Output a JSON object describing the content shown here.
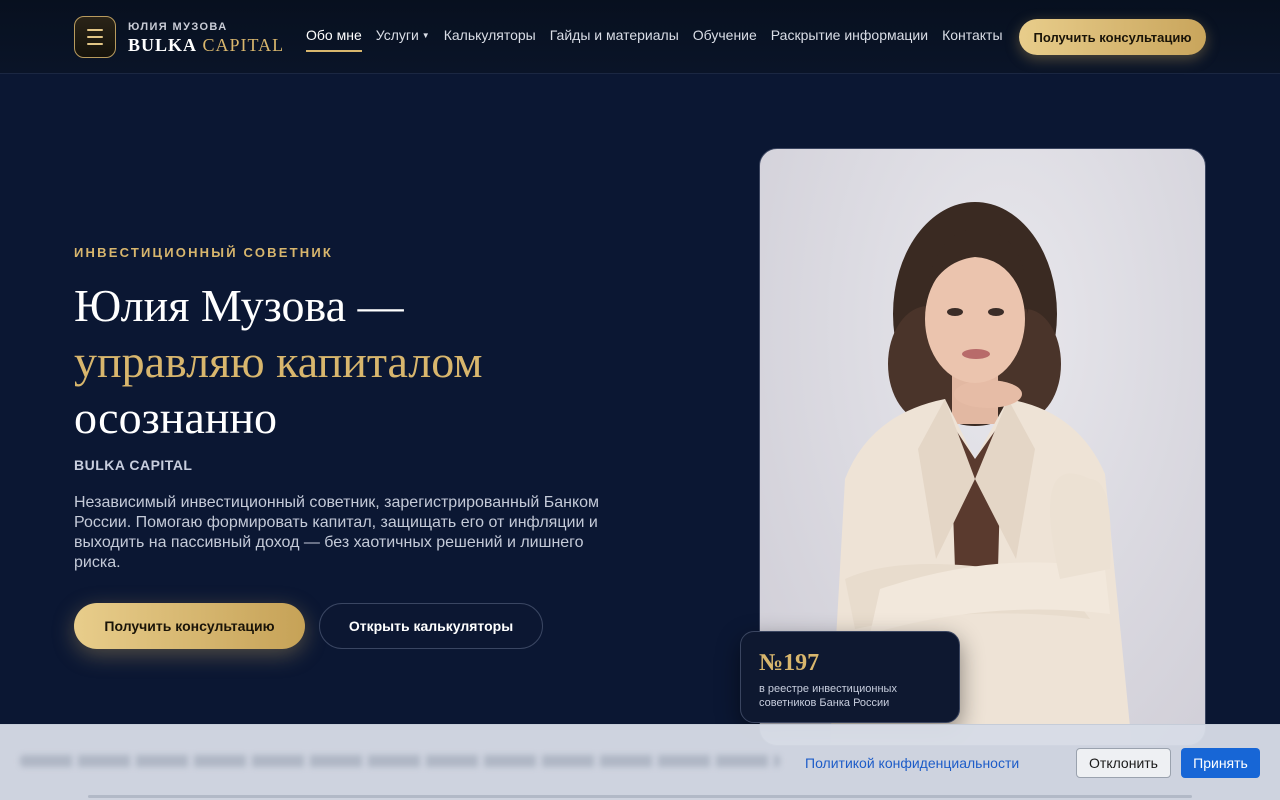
{
  "header": {
    "menu_icon": "hamburger-menu-icon",
    "brand_top": "ЮЛИЯ МУЗОВА",
    "brand_part1": "BULKA",
    "brand_part2": "CAPITAL",
    "nav": [
      {
        "label": "Обо мне",
        "active": true
      },
      {
        "label": "Услуги",
        "dropdown": true
      },
      {
        "label": "Калькуляторы"
      },
      {
        "label": "Гайды и материалы"
      },
      {
        "label": "Обучение"
      },
      {
        "label": "Раскрытие информации"
      },
      {
        "label": "Контакты"
      }
    ],
    "cta_label": "Получить консультацию"
  },
  "hero": {
    "eyebrow": "ИНВЕСТИЦИОННЫЙ СОВЕТНИК",
    "title_line1": "Юлия Музова —",
    "title_line2": "управляю капиталом",
    "title_line3": "осознанно",
    "sub_brand": "BULKA CAPITAL",
    "lead": "Независимый инвестиционный советник, зарегистрированный Банком России. Помогаю формировать капитал, защищать его от инфляции и выходить на пассивный доход — без хаотичных решений и лишнего риска.",
    "primary_button": "Получить консультацию",
    "secondary_button": "Открыть калькуляторы"
  },
  "badge": {
    "number": "№197",
    "text": "в реестре инвестиционных советников Банка России"
  },
  "cookie": {
    "policy_link": "Политикой конфиденциальности",
    "decline": "Отклонить",
    "accept": "Принять"
  },
  "colors": {
    "background": "#0b1733",
    "gold": "#d8b66d",
    "accept_blue": "#1766d6"
  }
}
